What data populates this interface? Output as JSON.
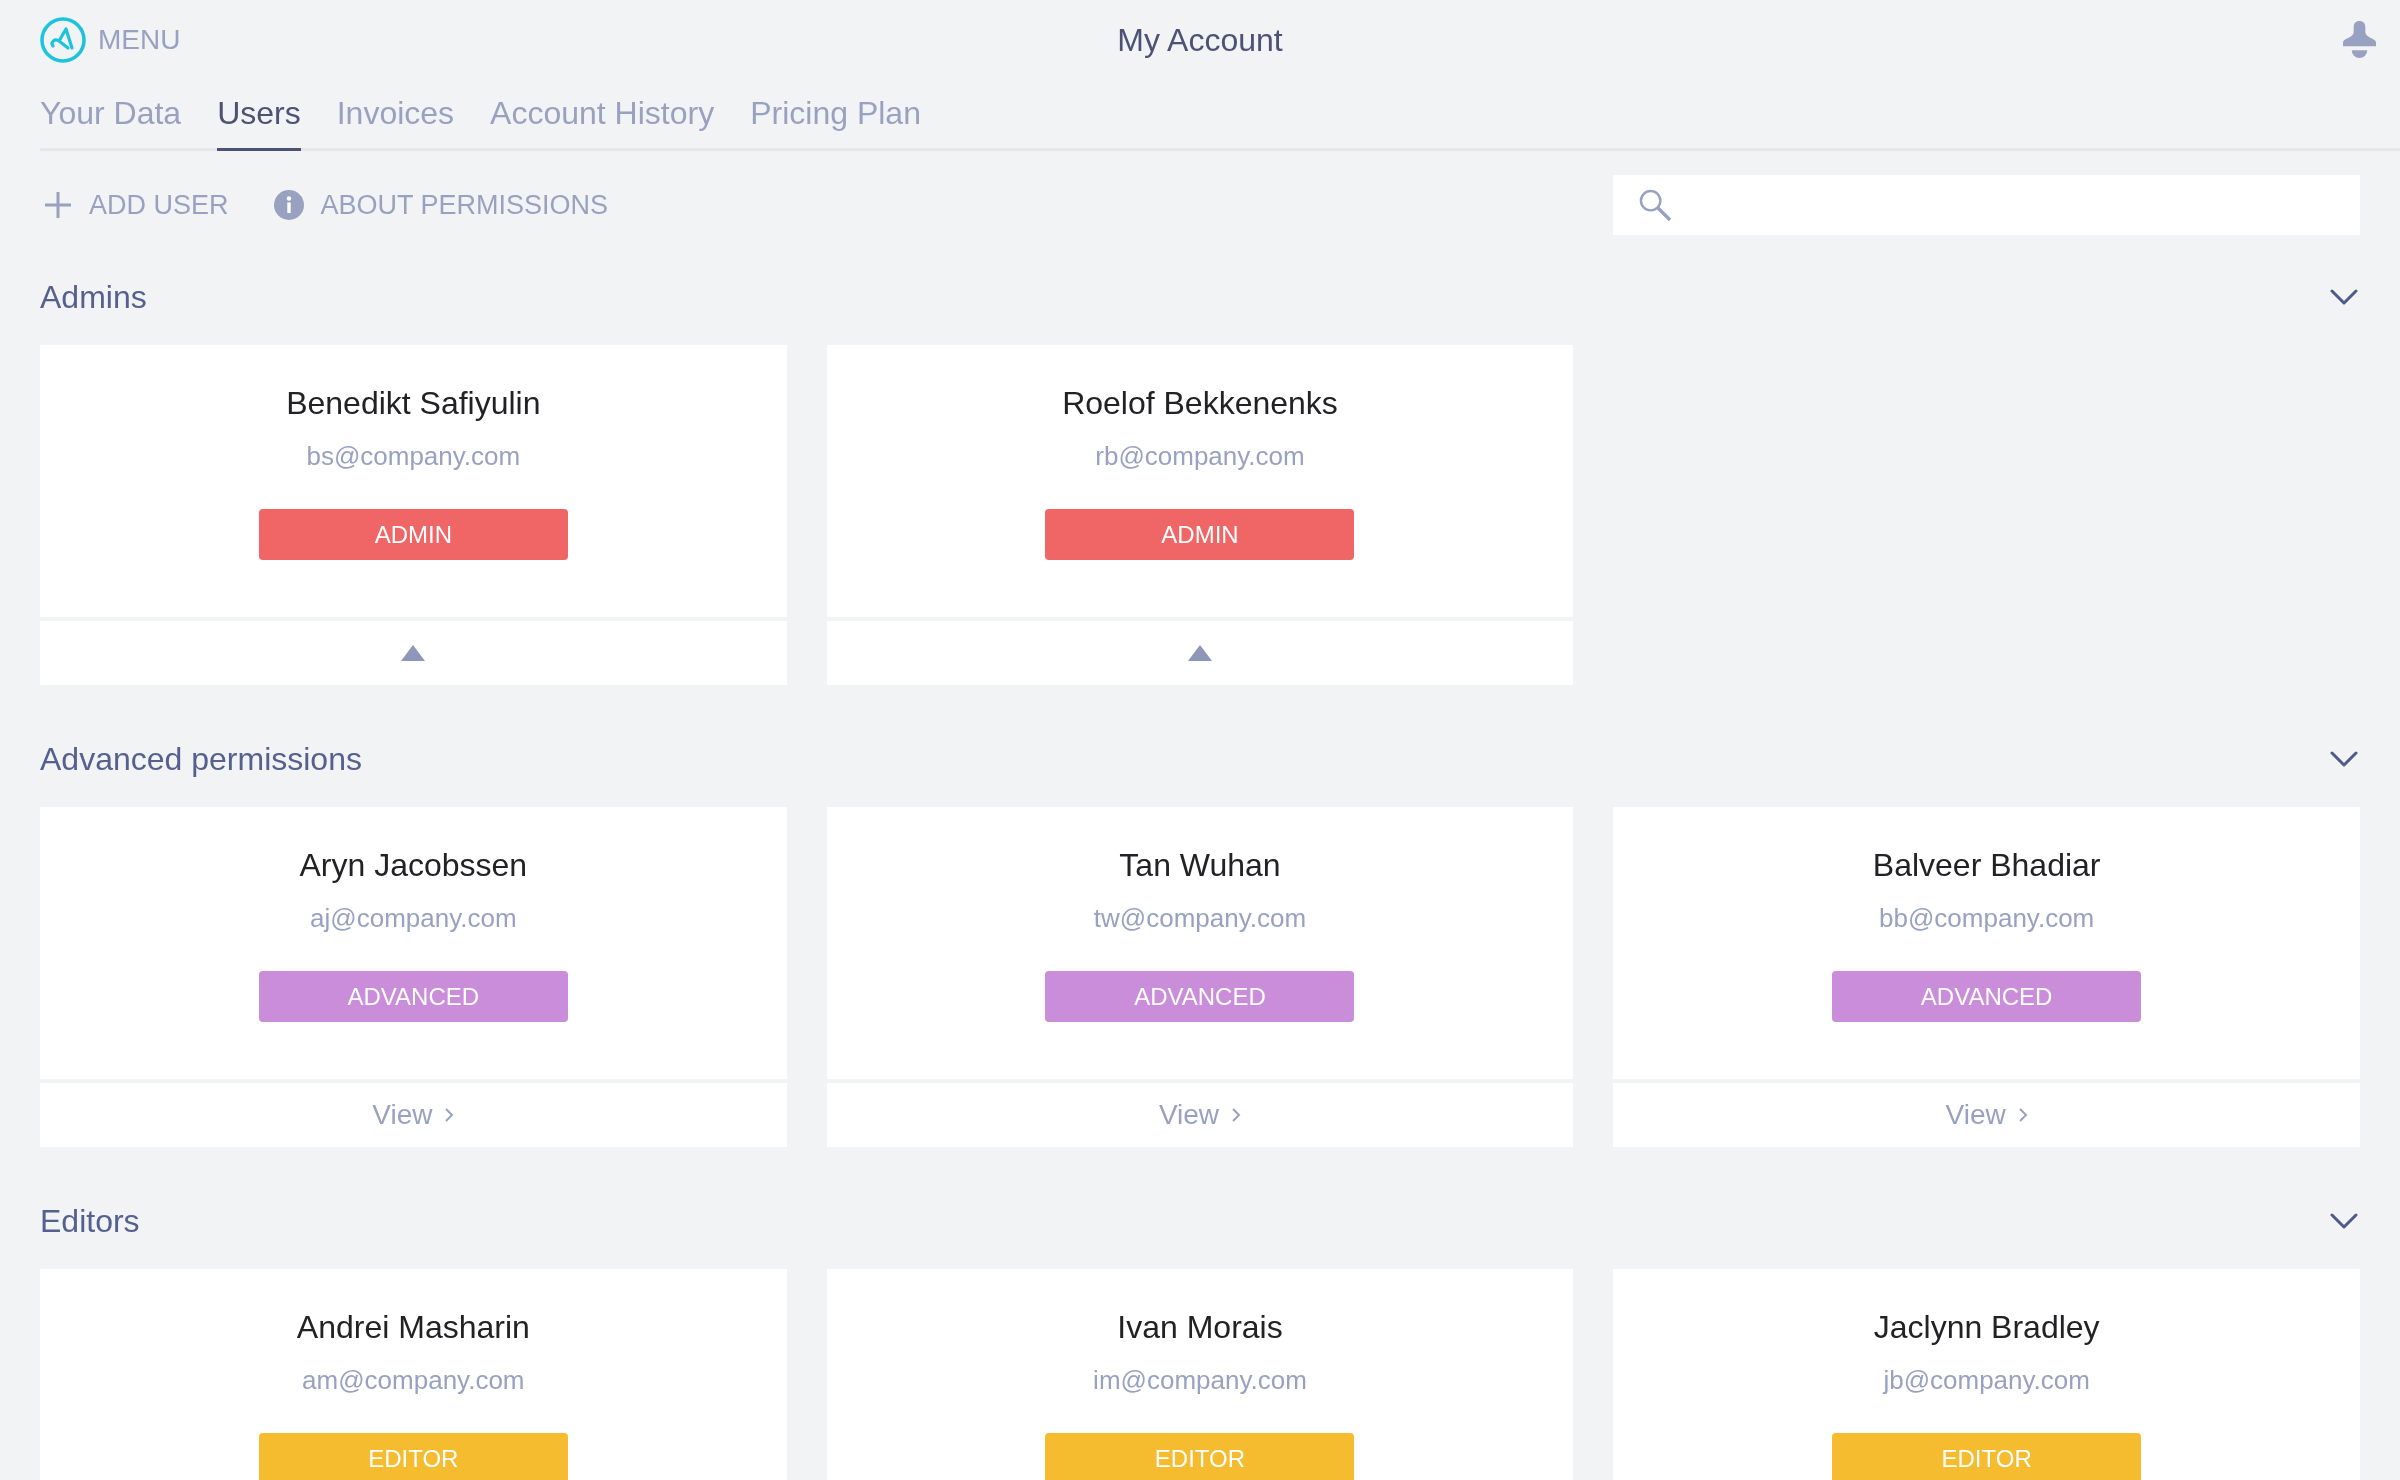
{
  "header": {
    "menu_label": "MENU",
    "title": "My Account"
  },
  "tabs": [
    {
      "label": "Your Data",
      "selected": false
    },
    {
      "label": "Users",
      "selected": true
    },
    {
      "label": "Invoices",
      "selected": false
    },
    {
      "label": "Account History",
      "selected": false
    },
    {
      "label": "Pricing Plan",
      "selected": false
    }
  ],
  "toolbar": {
    "actions": [
      {
        "kind": "add",
        "label": "ADD USER"
      },
      {
        "kind": "info",
        "label": "ABOUT PERMISSIONS"
      }
    ]
  },
  "sections": [
    {
      "title": "Admins",
      "expanded": true,
      "users": [
        {
          "name": "Benedikt Safiyulin",
          "email": "bs@company.com",
          "role": "ADMIN",
          "color": "#f06565",
          "footer": {
            "kind": "toggle"
          }
        },
        {
          "name": "Roelof Bekkenenks",
          "email": "rb@company.com",
          "role": "ADMIN",
          "color": "#f06565",
          "footer": {
            "kind": "toggle"
          }
        }
      ]
    },
    {
      "title": "Advanced permissions",
      "expanded": true,
      "users": [
        {
          "name": "Aryn Jacobssen",
          "email": "aj@company.com",
          "role": "ADVANCED",
          "color": "#c98dd9",
          "footer": {
            "kind": "link",
            "label": "View"
          }
        },
        {
          "name": "Tan Wuhan",
          "email": "tw@company.com",
          "role": "ADVANCED",
          "color": "#c98dd9",
          "footer": {
            "kind": "link",
            "label": "View"
          }
        },
        {
          "name": "Balveer Bhadiar",
          "email": "bb@company.com",
          "role": "ADVANCED",
          "color": "#c98dd9",
          "footer": {
            "kind": "link",
            "label": "View"
          }
        }
      ]
    },
    {
      "title": "Editors",
      "expanded": true,
      "users": [
        {
          "name": "Andrei Masharin",
          "email": "am@company.com",
          "role": "EDITOR",
          "color": "#f6bc30"
        },
        {
          "name": "Ivan Morais",
          "email": "im@company.com",
          "role": "EDITOR",
          "color": "#f6bc30"
        },
        {
          "name": "Jaclynn Bradley",
          "email": "jb@company.com",
          "role": "EDITOR",
          "color": "#f6bc30"
        }
      ]
    }
  ]
}
